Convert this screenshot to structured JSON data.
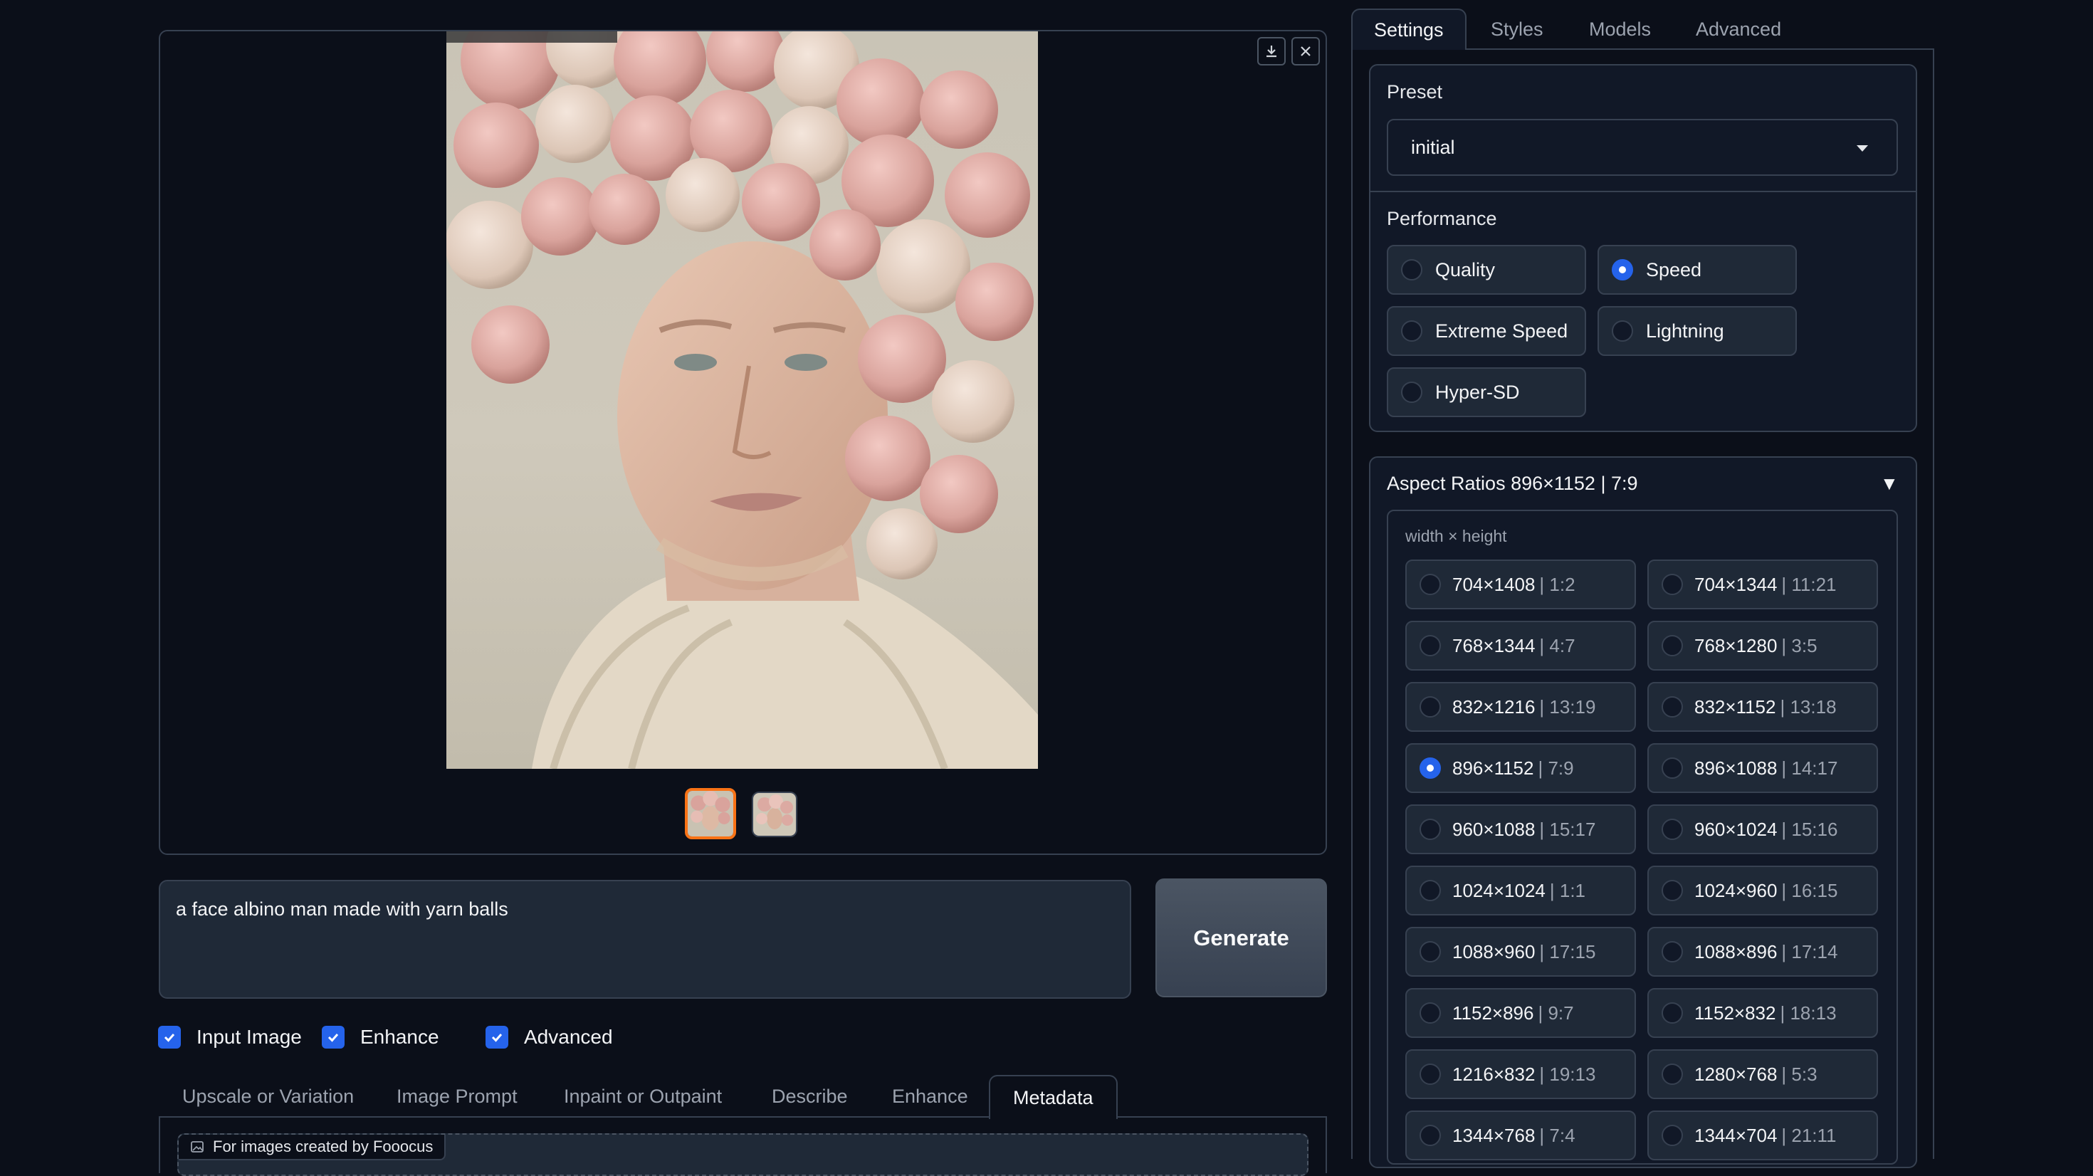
{
  "gallery": {
    "thumbnails": [
      "thumbnail-1",
      "thumbnail-2"
    ],
    "download_icon": "download-icon",
    "close_icon": "close-icon"
  },
  "prompt": {
    "value": "a face albino man made with yarn balls"
  },
  "generate_label": "Generate",
  "checkboxes": [
    {
      "label": "Input Image",
      "checked": true
    },
    {
      "label": "Enhance",
      "checked": true
    },
    {
      "label": "Advanced",
      "checked": true
    }
  ],
  "bottom_tabs": [
    "Upscale or Variation",
    "Image Prompt",
    "Inpaint or Outpaint",
    "Describe",
    "Enhance",
    "Metadata"
  ],
  "active_bottom_tab": "Metadata",
  "metadata_label": "For images created by Fooocus",
  "right_tabs": [
    "Settings",
    "Styles",
    "Models",
    "Advanced"
  ],
  "active_right_tab": "Settings",
  "preset": {
    "label": "Preset",
    "value": "initial"
  },
  "performance": {
    "label": "Performance",
    "options": [
      "Quality",
      "Speed",
      "Extreme Speed",
      "Lightning",
      "Hyper-SD"
    ],
    "selected": "Speed"
  },
  "aspect": {
    "title": "Aspect Ratios 896×1152 | 7:9",
    "toggle": "▼",
    "subtitle": "width × height",
    "selected": "896×1152",
    "options": [
      {
        "dim": "704×1408",
        "ratio": "| 1:2"
      },
      {
        "dim": "704×1344",
        "ratio": "| 11:21"
      },
      {
        "dim": "768×1344",
        "ratio": "| 4:7"
      },
      {
        "dim": "768×1280",
        "ratio": "| 3:5"
      },
      {
        "dim": "832×1216",
        "ratio": "| 13:19"
      },
      {
        "dim": "832×1152",
        "ratio": "| 13:18"
      },
      {
        "dim": "896×1152",
        "ratio": "| 7:9"
      },
      {
        "dim": "896×1088",
        "ratio": "| 14:17"
      },
      {
        "dim": "960×1088",
        "ratio": "| 15:17"
      },
      {
        "dim": "960×1024",
        "ratio": "| 15:16"
      },
      {
        "dim": "1024×1024",
        "ratio": "| 1:1"
      },
      {
        "dim": "1024×960",
        "ratio": "| 16:15"
      },
      {
        "dim": "1088×960",
        "ratio": "| 17:15"
      },
      {
        "dim": "1088×896",
        "ratio": "| 17:14"
      },
      {
        "dim": "1152×896",
        "ratio": "| 9:7"
      },
      {
        "dim": "1152×832",
        "ratio": "| 18:13"
      },
      {
        "dim": "1216×832",
        "ratio": "| 19:13"
      },
      {
        "dim": "1280×768",
        "ratio": "| 5:3"
      },
      {
        "dim": "1344×768",
        "ratio": "| 7:4"
      },
      {
        "dim": "1344×704",
        "ratio": "| 21:11"
      }
    ]
  },
  "colors": {
    "accent": "#2563eb",
    "thumb_border": "#f97316",
    "background": "#0b0f19"
  }
}
